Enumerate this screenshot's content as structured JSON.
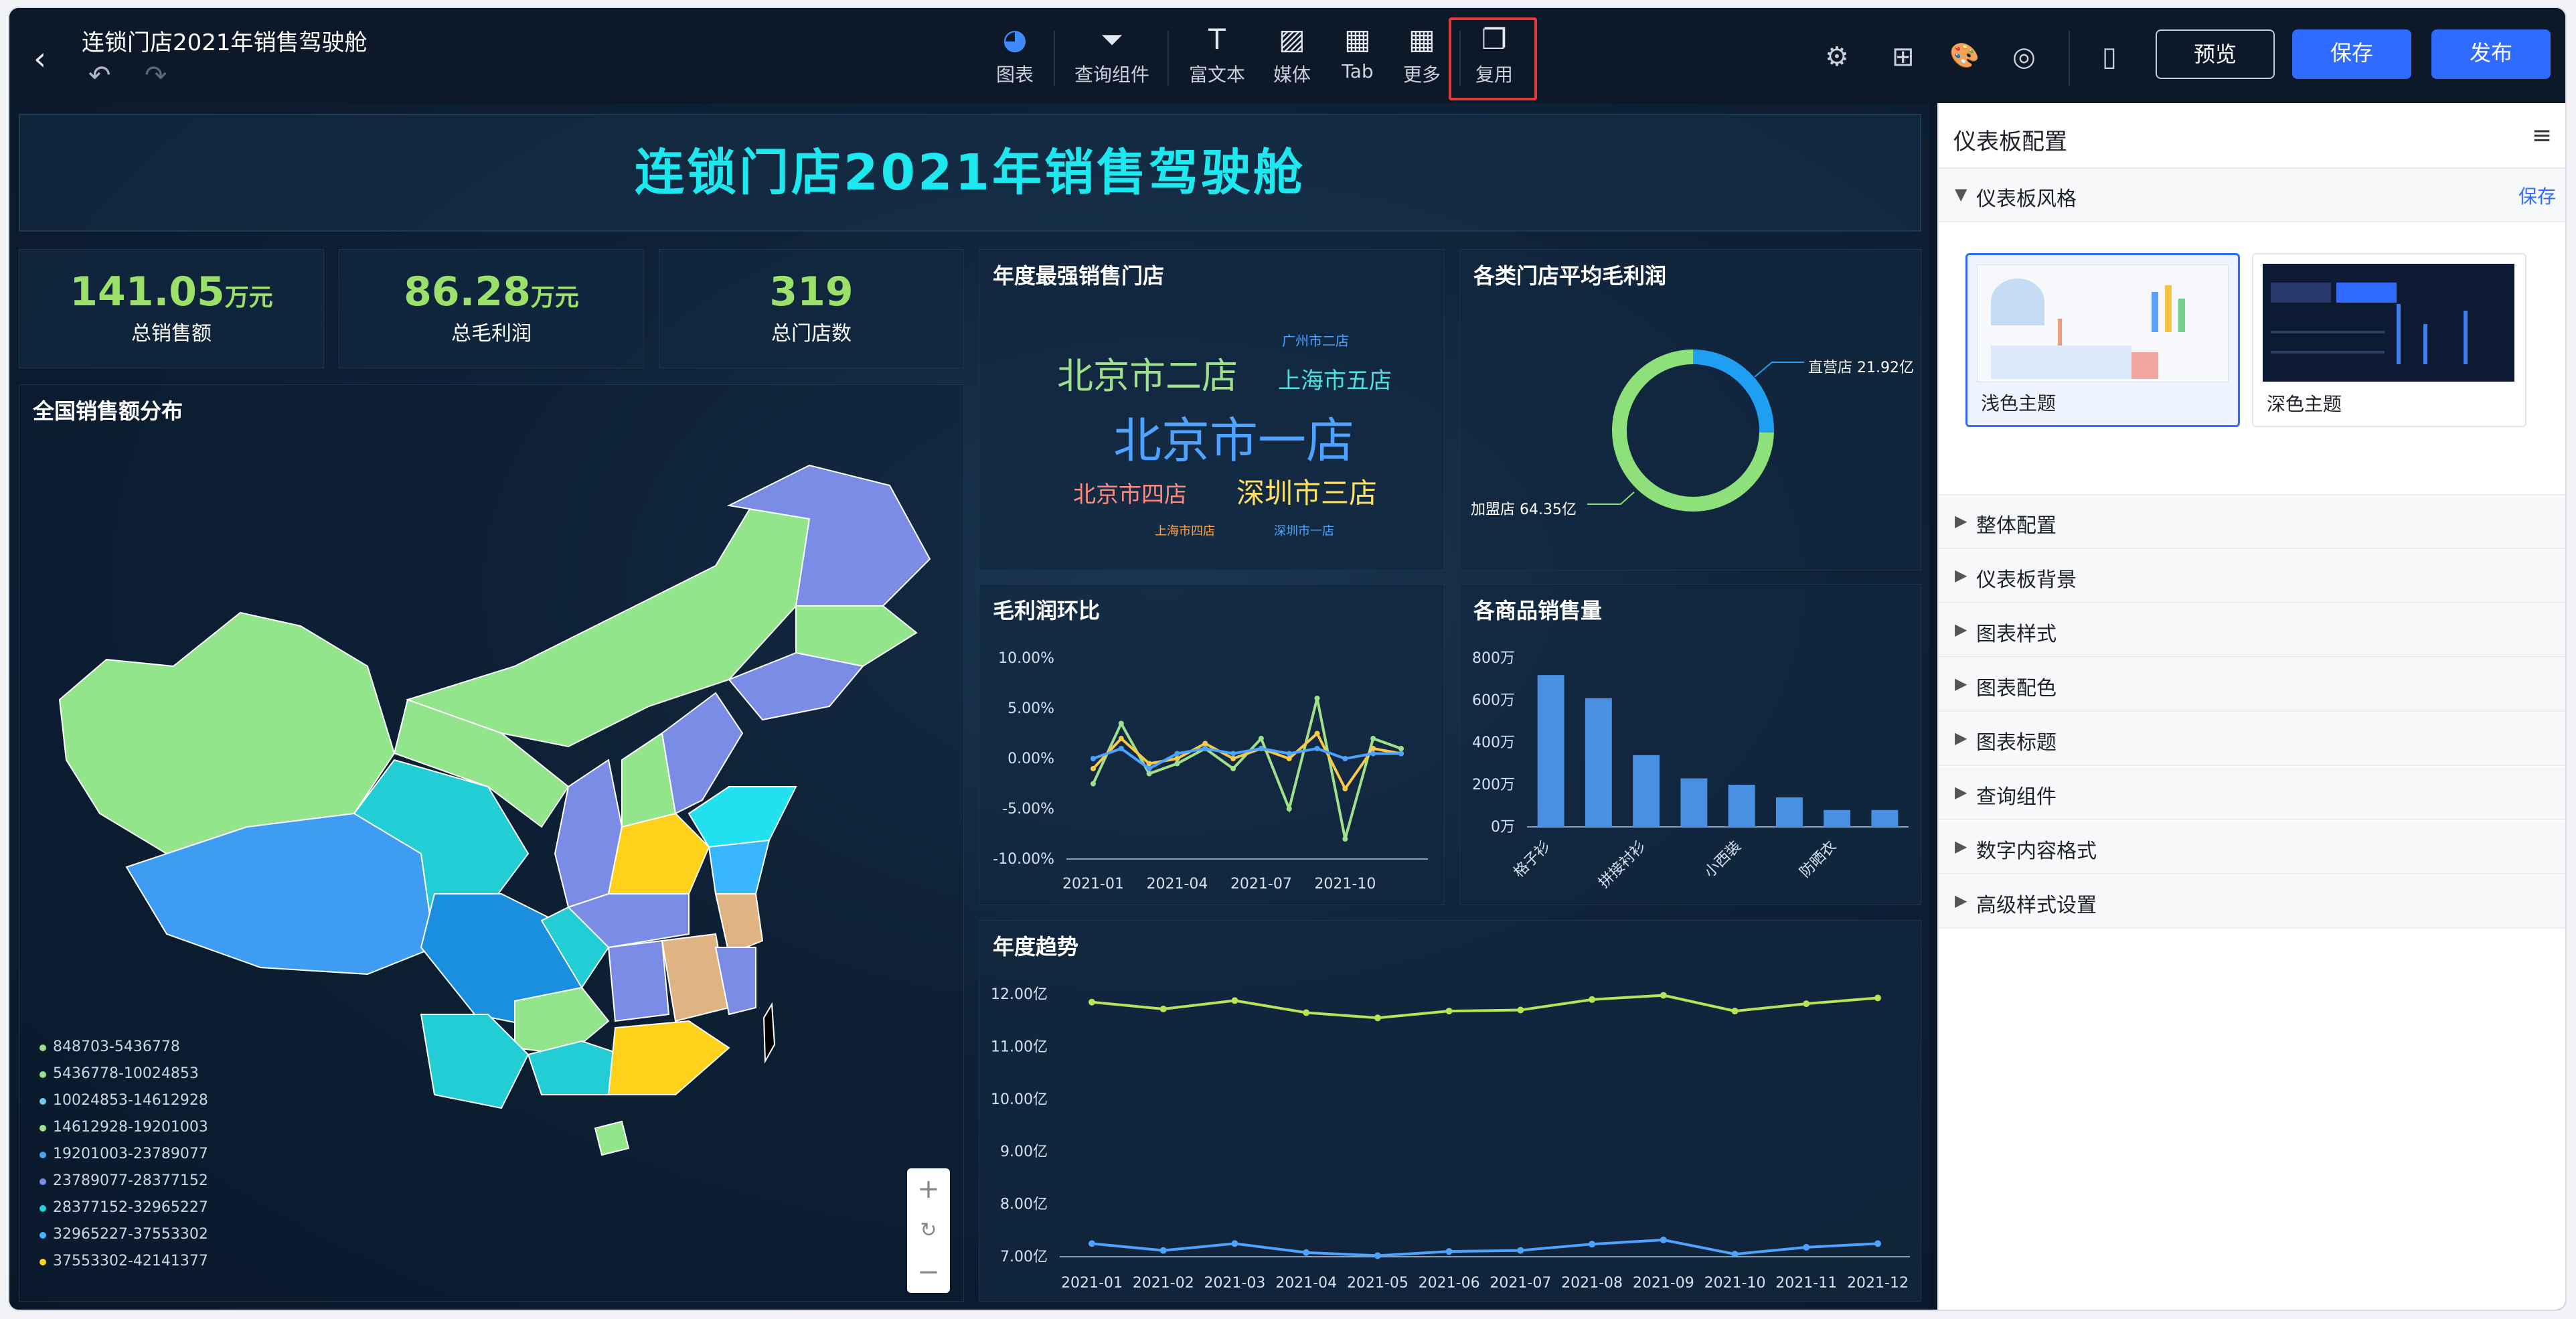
{
  "topbar": {
    "title": "连锁门店2021年销售驾驶舱",
    "back": "‹",
    "undo": "↶",
    "redo": "↷",
    "tools": [
      {
        "label": "图表",
        "icon": "◕"
      },
      {
        "label": "查询组件",
        "icon": "⏷"
      },
      {
        "label": "富文本",
        "icon": "T"
      },
      {
        "label": "媒体",
        "icon": "▨"
      },
      {
        "label": "Tab",
        "icon": "▦"
      },
      {
        "label": "更多",
        "icon": "▦"
      },
      {
        "label": "复用",
        "icon": "❐"
      }
    ],
    "right_icons": [
      "⚙",
      "⊞",
      "🎨",
      "◎",
      "▯"
    ],
    "preview": "预览",
    "save": "保存",
    "publish": "发布"
  },
  "dashboard": {
    "banner": "连锁门店2021年销售驾驶舱",
    "kpis": [
      {
        "value": "141.05",
        "unit": "万元",
        "label": "总销售额"
      },
      {
        "value": "86.28",
        "unit": "万元",
        "label": "总毛利润"
      },
      {
        "value": "319",
        "unit": "",
        "label": "总门店数"
      }
    ],
    "map": {
      "title": "全国销售额分布",
      "legend": [
        {
          "label": "848703-5436778",
          "color": "#9ee08b"
        },
        {
          "label": "5436778-10024853",
          "color": "#9ee08b"
        },
        {
          "label": "10024853-14612928",
          "color": "#72c9f0"
        },
        {
          "label": "14612928-19201003",
          "color": "#9ee08b"
        },
        {
          "label": "19201003-23789077",
          "color": "#4aa3f0"
        },
        {
          "label": "23789077-28377152",
          "color": "#7b8ce6"
        },
        {
          "label": "28377152-32965227",
          "color": "#22d3e0"
        },
        {
          "label": "32965227-37553302",
          "color": "#38b6ff"
        },
        {
          "label": "37553302-42141377",
          "color": "#ffd11a"
        }
      ],
      "zoom": {
        "plus": "+",
        "reset": "↻",
        "minus": "−"
      }
    },
    "wordcloud": {
      "title": "年度最强销售门店",
      "words": [
        {
          "text": "广州市二店",
          "color": "#4da3ff"
        },
        {
          "text": "北京市二店",
          "color": "#9ee08b"
        },
        {
          "text": "上海市五店",
          "color": "#4ee0e0"
        },
        {
          "text": "北京市一店",
          "color": "#4da3ff"
        },
        {
          "text": "北京市四店",
          "color": "#ff8a80"
        },
        {
          "text": "深圳市三店",
          "color": "#ffe066"
        },
        {
          "text": "上海市四店",
          "color": "#ff9f43"
        },
        {
          "text": "深圳市一店",
          "color": "#4da3ff"
        }
      ]
    },
    "donut": {
      "title": "各类门店平均毛利润",
      "labels": [
        "直营店 21.92亿",
        "加盟店 64.35亿"
      ]
    },
    "line_mom": {
      "title": "毛利润环比",
      "yticks": [
        "10.00%",
        "5.00%",
        "0.00%",
        "-5.00%",
        "-10.00%"
      ],
      "xticks": [
        "2021-01",
        "2021-04",
        "2021-07",
        "2021-10"
      ]
    },
    "bars": {
      "title": "各商品销售量",
      "yticks": [
        "800万",
        "600万",
        "400万",
        "200万",
        "0万"
      ],
      "xticks": [
        "格子衫",
        "拼接衬衫",
        "小西装",
        "防晒衣"
      ]
    },
    "trend": {
      "title": "年度趋势",
      "yticks": [
        "12.00亿",
        "11.00亿",
        "10.00亿",
        "9.00亿",
        "8.00亿",
        "7.00亿"
      ],
      "xticks": [
        "2021-01",
        "2021-02",
        "2021-03",
        "2021-04",
        "2021-05",
        "2021-06",
        "2021-07",
        "2021-08",
        "2021-09",
        "2021-10",
        "2021-11",
        "2021-12"
      ]
    }
  },
  "rightpanel": {
    "title": "仪表板配置",
    "menu": "≡",
    "style_section": "仪表板风格",
    "save": "保存",
    "themes": [
      {
        "label": "浅色主题"
      },
      {
        "label": "深色主题"
      }
    ],
    "sections": [
      "整体配置",
      "仪表板背景",
      "图表样式",
      "图表配色",
      "图表标题",
      "查询组件",
      "数字内容格式",
      "高级样式设置"
    ]
  },
  "chart_data": [
    {
      "type": "pie",
      "title": "各类门店平均毛利润",
      "categories": [
        "直营店",
        "加盟店"
      ],
      "values": [
        21.92,
        64.35
      ],
      "colors": [
        "#1e9ff2",
        "#8ee07b"
      ],
      "unit": "亿"
    },
    {
      "type": "line",
      "title": "毛利润环比",
      "ylim": [
        -10,
        10
      ],
      "x_tick_labels": [
        "2021-01",
        "2021-04",
        "2021-07",
        "2021-10"
      ],
      "x": [
        1,
        2,
        3,
        4,
        5,
        6,
        7,
        8,
        9,
        10,
        11,
        12
      ],
      "series": [
        {
          "values": [
            -2.5,
            3.5,
            -1.5,
            -0.5,
            1,
            -1,
            2,
            -5,
            6,
            -8,
            2,
            1
          ],
          "color": "#9ee08b"
        },
        {
          "values": [
            -1,
            2,
            -0.5,
            0,
            1.5,
            0,
            1,
            0,
            2.5,
            -3,
            1,
            0.5
          ],
          "color": "#f7c948"
        },
        {
          "values": [
            0,
            1,
            -1,
            0.5,
            1,
            0.5,
            1,
            0.5,
            1,
            0,
            0.5,
            0.5
          ],
          "color": "#4da3ff"
        }
      ]
    },
    {
      "type": "bar",
      "title": "各商品销售量",
      "categories": [
        "格子衫",
        "",
        "拼接衬衫",
        "",
        "小西装",
        "",
        "防晒衣",
        ""
      ],
      "values": [
        720,
        610,
        340,
        230,
        200,
        140,
        80,
        80
      ],
      "ylim": [
        0,
        800
      ],
      "color": "#4a90e2"
    },
    {
      "type": "line",
      "title": "年度趋势",
      "categories": [
        "2021-01",
        "2021-02",
        "2021-03",
        "2021-04",
        "2021-05",
        "2021-06",
        "2021-07",
        "2021-08",
        "2021-09",
        "2021-10",
        "2021-11",
        "2021-12"
      ],
      "ylim": [
        7,
        12
      ],
      "series": [
        {
          "values": [
            11.85,
            11.72,
            11.88,
            11.65,
            11.55,
            11.68,
            11.7,
            11.9,
            11.98,
            11.68,
            11.82,
            11.93
          ],
          "color": "#b6e35a"
        },
        {
          "values": [
            7.25,
            7.12,
            7.25,
            7.08,
            7.02,
            7.1,
            7.12,
            7.24,
            7.32,
            7.05,
            7.18,
            7.25
          ],
          "color": "#4da3ff"
        }
      ]
    }
  ]
}
